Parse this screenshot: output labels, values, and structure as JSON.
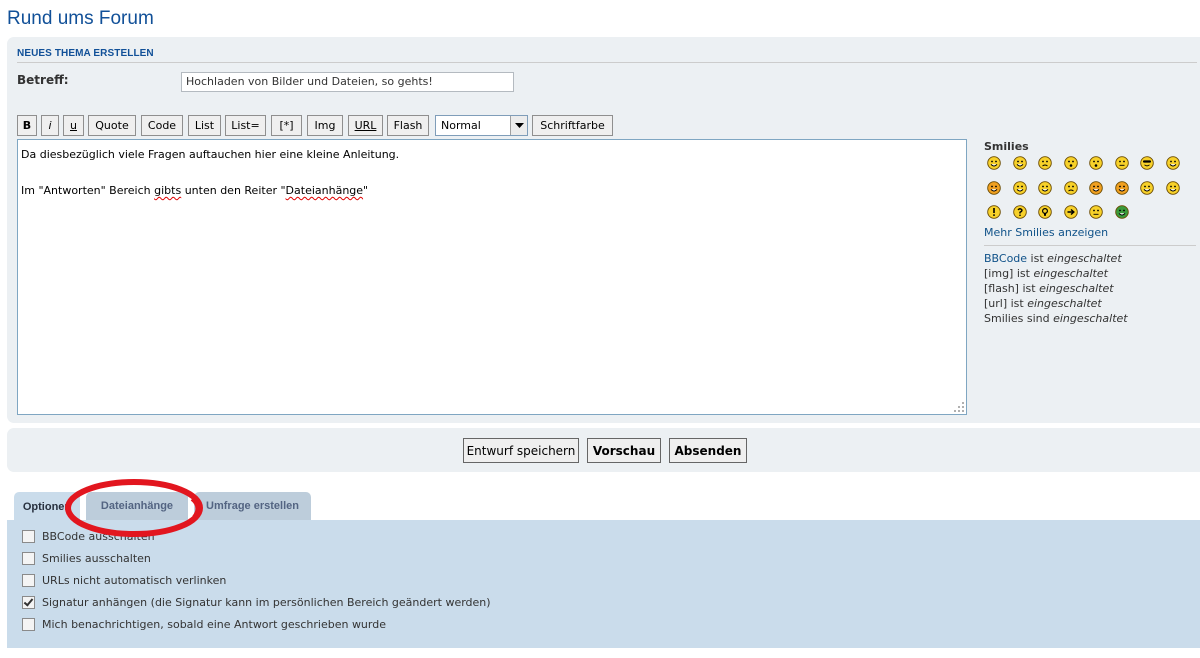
{
  "page": {
    "title": "Rund ums Forum"
  },
  "post": {
    "section_title": "NEUES THEMA ERSTELLEN",
    "subject_label": "Betreff:",
    "subject_value": "Hochladen von Bilder und Dateien, so gehts!"
  },
  "toolbar": {
    "bold": "B",
    "italic": "i",
    "underline": "u",
    "quote": "Quote",
    "code": "Code",
    "list": "List",
    "list_eq": "List=",
    "list_item": "[*]",
    "img": "Img",
    "url": "URL",
    "flash": "Flash",
    "font_size_value": "Normal",
    "font_color": "Schriftfarbe"
  },
  "editor": {
    "line1": "Da diesbezüglich viele Fragen auftauchen hier eine kleine Anleitung.",
    "line2_a": "Im \"Antworten\" Bereich ",
    "line2_b": "gibts",
    "line2_c": " unten den Reiter \"",
    "line2_d": "Dateianhänge",
    "line2_e": "\""
  },
  "smilies": {
    "heading": "Smilies",
    "icons": [
      "biggrin-smiley-icon",
      "smile-smiley-icon",
      "sad-smiley-icon",
      "surprised-smiley-icon",
      "eek-smiley-icon",
      "confused-smiley-icon",
      "cool-smiley-icon",
      "lol-smiley-icon",
      "mad-smiley-icon",
      "razz-smiley-icon",
      "redface-smiley-icon",
      "cry-smiley-icon",
      "evil-smiley-icon",
      "twisted-smiley-icon",
      "rolleyes-smiley-icon",
      "wink-smiley-icon",
      "exclaim-smiley-icon",
      "question-smiley-icon",
      "idea-smiley-icon",
      "arrow-smiley-icon",
      "neutral-smiley-icon",
      "mrgreen-smiley-icon"
    ],
    "more_link": "Mehr Smilies anzeigen"
  },
  "status": {
    "bbcode_link": "BBCode",
    "bbcode_text": " ist ",
    "bbcode_state": "eingeschaltet",
    "img_text": "[img] ist ",
    "img_state": "eingeschaltet",
    "flash_text": "[flash] ist ",
    "flash_state": "eingeschaltet",
    "url_text": "[url] ist ",
    "url_state": "eingeschaltet",
    "smilies_text": "Smilies sind ",
    "smilies_state": "eingeschaltet"
  },
  "actions": {
    "save_draft": "Entwurf speichern",
    "preview": "Vorschau",
    "submit": "Absenden"
  },
  "tabs": [
    {
      "label": "Optionen"
    },
    {
      "label": "Dateianhänge"
    },
    {
      "label": "Umfrage erstellen"
    }
  ],
  "options": [
    {
      "label": "BBCode ausschalten",
      "checked": false
    },
    {
      "label": "Smilies ausschalten",
      "checked": false
    },
    {
      "label": "URLs nicht automatisch verlinken",
      "checked": false
    },
    {
      "label": "Signatur anhängen (die Signatur kann im persönlichen Bereich geändert werden)",
      "checked": true
    },
    {
      "label": "Mich benachrichtigen, sobald eine Antwort geschrieben wurde",
      "checked": false
    }
  ],
  "colors": {
    "accent": "#115098",
    "panel": "#ecf0f3",
    "options_panel": "#cadceb",
    "highlight": "#e2161f"
  }
}
